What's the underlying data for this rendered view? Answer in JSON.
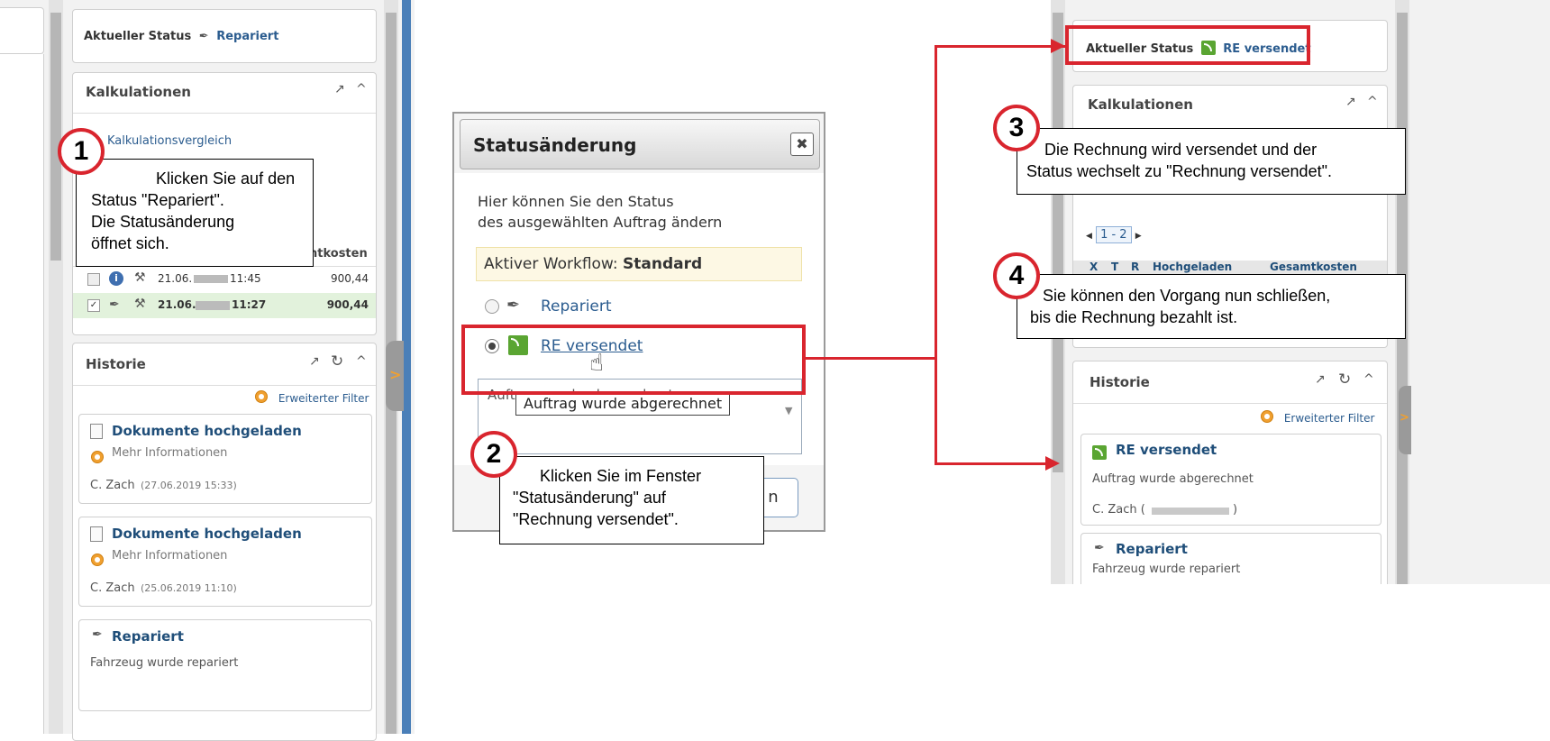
{
  "left_panel": {
    "status_label": "Aktueller Status",
    "status_value": "Repariert",
    "kalk_title": "Kalkulationen",
    "kalk_link": "Kalkulationsvergleich",
    "col_header": "ntkosten",
    "rows": [
      {
        "date": "21.06.",
        "time": "11:45",
        "value": "900,44"
      },
      {
        "date": "21.06.",
        "time": "11:27",
        "value": "900,44"
      }
    ],
    "historie_title": "Historie",
    "filter_label": "Erweiterter Filter",
    "cards": [
      {
        "title": "Dokumente hochgeladen",
        "more": "Mehr Informationen",
        "user": "C. Zach",
        "date": "(27.06.2019 15:33)"
      },
      {
        "title": "Dokumente hochgeladen",
        "more": "Mehr Informationen",
        "user": "C. Zach",
        "date": "(25.06.2019 11:10)"
      },
      {
        "title": "Repariert",
        "text": "Fahrzeug wurde repariert"
      }
    ]
  },
  "dialog": {
    "title": "Statusänderung",
    "description_line1": "Hier können Sie den Status",
    "description_line2": "des ausgewählten Auftrag ändern",
    "workflow_label": "Aktiver Workflow:",
    "workflow_value": "Standard",
    "option1": "Repariert",
    "option2": "RE versendet",
    "textarea_value": "Auftrag wurde abgerechnet",
    "tooltip": "Auftrag wurde abgerechnet",
    "button_partial": "n"
  },
  "right_panel": {
    "status_label": "Aktueller Status",
    "status_value": "RE versendet",
    "kalk_title": "Kalkulationen",
    "pager": "1 - 2",
    "table_headers": [
      "X",
      "T",
      "R",
      "Hochgeladen",
      "Gesamtkosten"
    ],
    "historie_title": "Historie",
    "filter_label": "Erweiterter Filter",
    "card1_title": "RE versendet",
    "card1_text": "Auftrag wurde abgerechnet",
    "card1_user": "C. Zach (",
    "card1_user_end": ")",
    "card2_title": "Repariert",
    "card2_text": "Fahrzeug wurde repariert"
  },
  "callouts": {
    "c1_num": "1",
    "c1_line1": "Klicken Sie auf den",
    "c1_line2": "Status \"Repariert\".",
    "c1_line3": "Die Statusänderung",
    "c1_line4": "öffnet sich.",
    "c2_num": "2",
    "c2_line1": "Klicken Sie im Fenster",
    "c2_line2": "\"Statusänderung\" auf",
    "c2_line3": "\"Rechnung versendet\".",
    "c3_num": "3",
    "c3_line1": "Die Rechnung wird versendet und der",
    "c3_line2": "Status wechselt zu \"Rechnung versendet\".",
    "c4_num": "4",
    "c4_line1": "Sie können den Vorgang nun schließen,",
    "c4_line2": "bis die Rechnung bezahlt ist."
  },
  "colors": {
    "accent_red": "#d9252e",
    "link_blue": "#2b5c8f",
    "row_highlight": "#e2f2dc"
  }
}
